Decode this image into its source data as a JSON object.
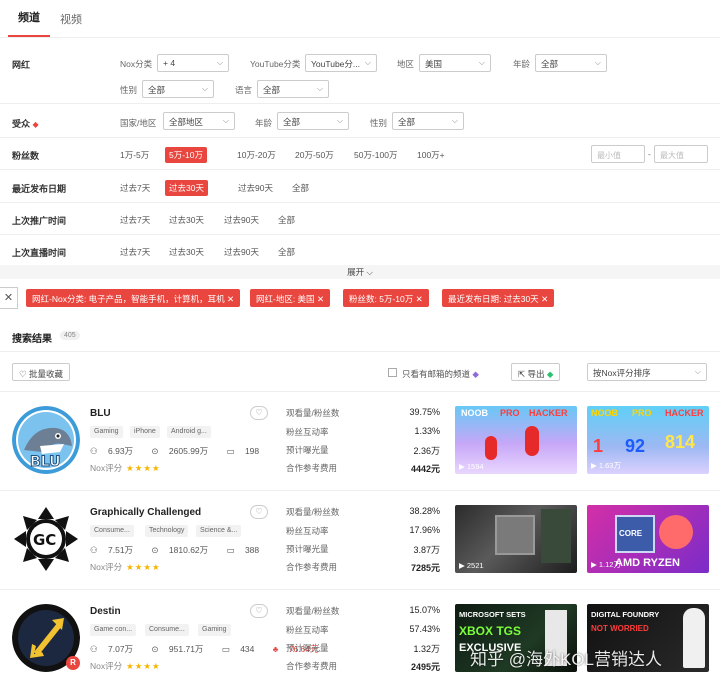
{
  "tabs": [
    {
      "label": "频道"
    },
    {
      "label": "视频"
    }
  ],
  "filters": {
    "kol": {
      "label": "网红",
      "nox_category_label": "Nox分类",
      "nox_category_value": "+ 4",
      "youtube_category_label": "YouTube分类",
      "youtube_category_value": "YouTube分...",
      "region_label": "地区",
      "region_value": "美国",
      "age_label": "年龄",
      "age_value": "全部",
      "gender_label": "性别",
      "gender_value": "全部",
      "language_label": "语言",
      "language_value": "全部"
    },
    "audience": {
      "label": "受众",
      "country_label": "国家/地区",
      "country_value": "全部地区",
      "age_label": "年龄",
      "age_value": "全部",
      "gender_label": "性别",
      "gender_value": "全部"
    },
    "followers": {
      "label": "粉丝数",
      "options": [
        "1万-5万",
        "5万-10万",
        "10万-20万",
        "20万-50万",
        "50万-100万",
        "100万+"
      ],
      "min_placeholder": "最小值",
      "separator": "-",
      "max_placeholder": "最大值"
    },
    "last_post": {
      "label": "最近发布日期",
      "options": [
        "过去7天",
        "过去30天",
        "过去90天",
        "全部"
      ]
    },
    "last_promo": {
      "label": "上次推广时间",
      "options": [
        "过去7天",
        "过去30天",
        "过去90天",
        "全部"
      ]
    },
    "last_live": {
      "label": "上次直播时间",
      "options": [
        "过去7天",
        "过去30天",
        "过去90天",
        "全部"
      ]
    }
  },
  "expand_label": "展开",
  "chips": [
    "网红-Nox分类: 电子产品，智能手机，计算机，耳机",
    "网红-地区: 美国",
    "粉丝数: 5万-10万",
    "最近发布日期: 过去30天"
  ],
  "results": {
    "title": "搜索结果",
    "count": "405"
  },
  "toolbar": {
    "bulk_collect": "批量收藏",
    "email_only": "只看有邮箱的频道",
    "export": "导出",
    "sort": "按Nox评分排序"
  },
  "metric_labels": [
    "观看量/粉丝数",
    "粉丝互动率",
    "预计曝光量",
    "合作参考费用"
  ],
  "rating_label": "Nox评分",
  "channels": [
    {
      "name": "BLU",
      "tags": [
        "Gaming",
        "iPhone",
        "Android g..."
      ],
      "followers": "6.93万",
      "views": "2605.99万",
      "videos": "198",
      "price": "",
      "stars": "★★★★",
      "metrics": [
        "39.75%",
        "1.33%",
        "2.36万",
        "4442元"
      ],
      "thumb1_views": "1594",
      "thumb1_text": [
        "NOOB",
        "PRO",
        "HACKER"
      ],
      "thumb2_views": "1.63万",
      "thumb2_text": [
        "NOOB",
        "PRO",
        "HACKER",
        "1",
        "92",
        "814"
      ]
    },
    {
      "name": "Graphically Challenged",
      "tags": [
        "Consume...",
        "Technology",
        "Science &..."
      ],
      "followers": "7.51万",
      "views": "1810.62万",
      "videos": "388",
      "price": "",
      "stars": "★★★★",
      "metrics": [
        "38.28%",
        "17.96%",
        "3.87万",
        "7285元"
      ],
      "thumb1_views": "2521",
      "thumb2_views": "1.12万",
      "thumb2_text": [
        "CORE",
        "AMD RYZEN"
      ]
    },
    {
      "name": "Destin",
      "tags": [
        "Game con...",
        "Consume...",
        "Gaming"
      ],
      "followers": "7.07万",
      "views": "951.71万",
      "videos": "434",
      "price": "76.64元",
      "stars": "★★★★",
      "metrics": [
        "15.07%",
        "57.43%",
        "1.32万",
        "2495元"
      ],
      "thumb1_text": [
        "MICROSOFT SETS",
        "XBOX TGS",
        "EXCLUSIVE"
      ],
      "thumb2_text": [
        "DIGITAL FOUNDRY",
        "NOT WORRIED"
      ]
    }
  ],
  "watermark": "知乎 @海外KOL营销达人",
  "colors": {
    "accent": "#e9463f",
    "star": "#f7b500"
  }
}
